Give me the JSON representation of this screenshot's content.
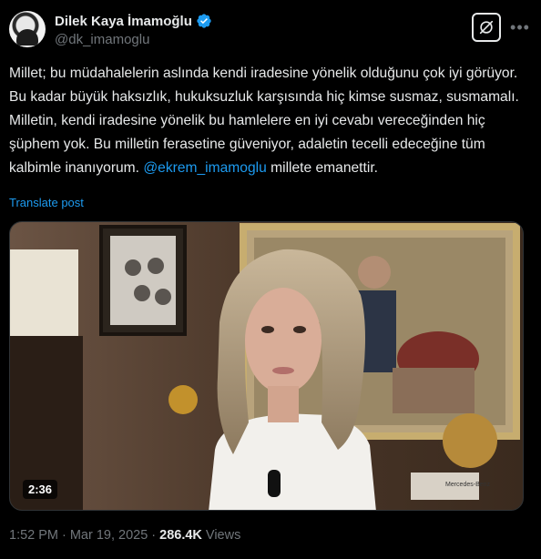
{
  "author": {
    "display_name": "Dilek Kaya İmamoğlu",
    "handle": "@dk_imamoglu",
    "verified": true
  },
  "tweet": {
    "text_before_mention": "Millet; bu müdahalelerin aslında kendi iradesine yönelik olduğunu çok iyi görüyor. Bu kadar büyük haksızlık, hukuksuzluk karşısında hiç kimse susmaz, susmamalı. Milletin, kendi iradesine yönelik bu hamlelere en iyi cevabı vereceğinden hiç şüphem yok. Bu milletin ferasetine güveniyor, adaletin tecelli edeceğine tüm kalbimle inanıyorum. ",
    "mention": "@ekrem_imamoglu",
    "text_after_mention": " millete emanettir.",
    "translate_label": "Translate post"
  },
  "media": {
    "duration": "2:36",
    "brand_text": "Mercedes-Benz"
  },
  "meta": {
    "time": "1:52 PM",
    "separator1": "·",
    "date": "Mar 19, 2025",
    "separator2": "·",
    "views_count": "286.4K",
    "views_label": "Views"
  },
  "colors": {
    "accent": "#1d9bf0",
    "secondary_text": "#71767b",
    "primary_text": "#e7e9ea",
    "background": "#000000"
  },
  "icons": [
    "verified-badge-icon",
    "grok-icon",
    "more-icon"
  ]
}
